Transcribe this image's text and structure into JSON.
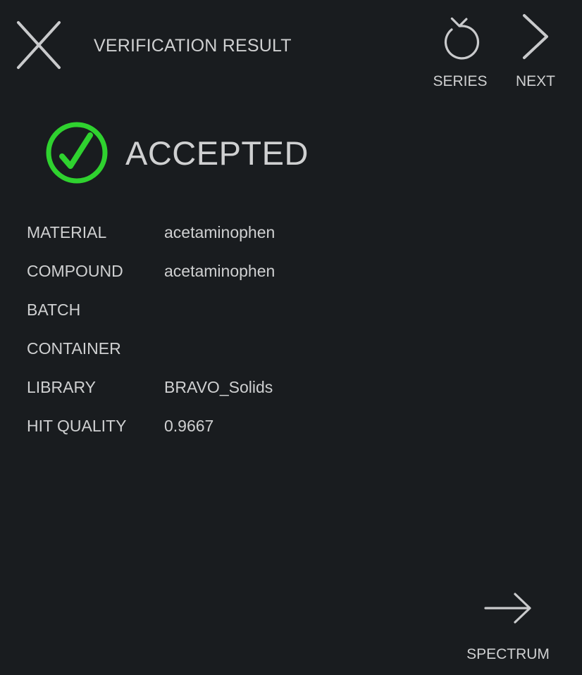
{
  "header": {
    "title": "VERIFICATION RESULT",
    "close_icon": "close-icon",
    "series": {
      "label": "SERIES",
      "icon": "undo-arrow-icon"
    },
    "next": {
      "label": "NEXT",
      "icon": "chevron-right-icon"
    }
  },
  "status": {
    "text": "ACCEPTED",
    "icon": "check-circle-icon",
    "color": "#2fd22f"
  },
  "details": [
    {
      "label": "MATERIAL",
      "value": "acetaminophen"
    },
    {
      "label": "COMPOUND",
      "value": "acetaminophen"
    },
    {
      "label": "BATCH",
      "value": ""
    },
    {
      "label": "CONTAINER",
      "value": ""
    },
    {
      "label": "LIBRARY",
      "value": "BRAVO_Solids"
    },
    {
      "label": "HIT QUALITY",
      "value": "0.9667"
    }
  ],
  "footer": {
    "spectrum": {
      "label": "SPECTRUM",
      "icon": "arrow-right-icon"
    }
  },
  "theme": {
    "background": "#191c1f",
    "text": "#cfd0d1",
    "icon_stroke": "#c9cacc"
  }
}
